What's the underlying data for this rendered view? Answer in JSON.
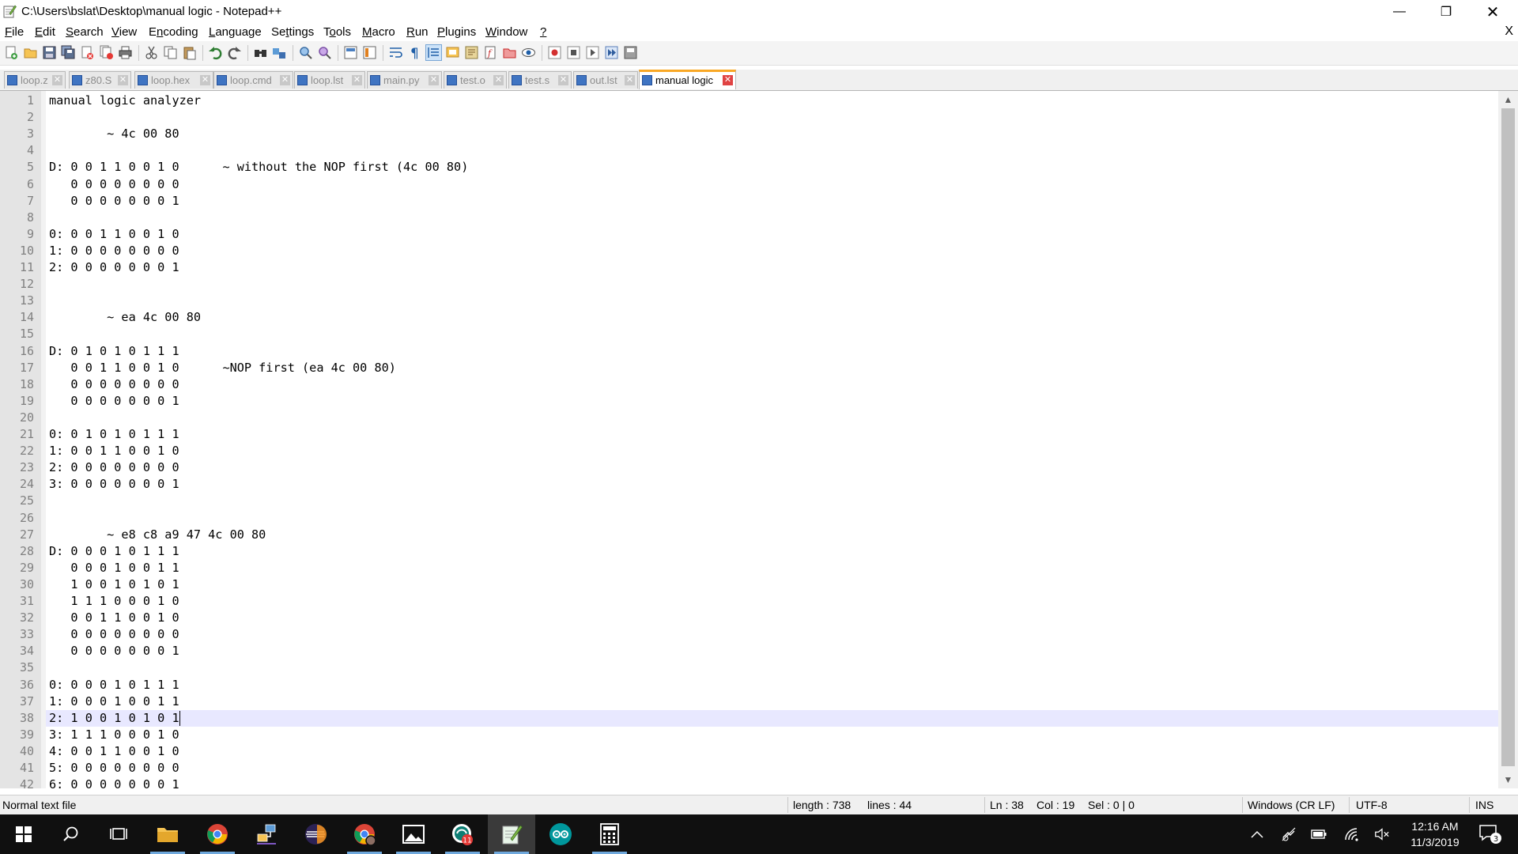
{
  "window": {
    "title": "C:\\Users\\bslat\\Desktop\\manual logic - Notepad++",
    "minimize": "—",
    "maximize": "❐",
    "close": "✕"
  },
  "menu": {
    "items": [
      {
        "u": "F",
        "rest": "ile"
      },
      {
        "u": "E",
        "rest": "dit"
      },
      {
        "u": "S",
        "rest": "earch"
      },
      {
        "u": "V",
        "rest": "iew"
      },
      {
        "u": "",
        "pre": "E",
        "u2": "n",
        "rest": "coding"
      },
      {
        "u": "L",
        "rest": "anguage"
      },
      {
        "u": "",
        "pre": "Se",
        "u2": "t",
        "rest": "tings"
      },
      {
        "u": "",
        "pre": "T",
        "u2": "o",
        "rest": "ols"
      },
      {
        "u": "M",
        "rest": "acro"
      },
      {
        "u": "R",
        "rest": "un"
      },
      {
        "u": "P",
        "rest": "lugins"
      },
      {
        "u": "W",
        "rest": "indow"
      },
      {
        "u": "?",
        "rest": ""
      }
    ],
    "close_doc": "X"
  },
  "tabs": [
    {
      "label": "loop.z",
      "active": false
    },
    {
      "label": "z80.S",
      "active": false
    },
    {
      "label": "loop.hex",
      "active": false
    },
    {
      "label": "loop.cmd",
      "active": false
    },
    {
      "label": "loop.lst",
      "active": false
    },
    {
      "label": "main.py",
      "active": false
    },
    {
      "label": "test.o",
      "active": false
    },
    {
      "label": "test.s",
      "active": false
    },
    {
      "label": "out.lst",
      "active": false
    },
    {
      "label": "manual logic",
      "active": true
    }
  ],
  "tab_close_glyph": "✕",
  "editor": {
    "first_line_number": 1,
    "current_line": 38,
    "caret_col": 19,
    "lines": [
      "manual logic analyzer",
      "",
      "        ~ 4c 00 80",
      "",
      "D: 0 0 1 1 0 0 1 0      ~ without the NOP first (4c 00 80)",
      "   0 0 0 0 0 0 0 0",
      "   0 0 0 0 0 0 0 1",
      "",
      "0: 0 0 1 1 0 0 1 0",
      "1: 0 0 0 0 0 0 0 0",
      "2: 0 0 0 0 0 0 0 1",
      "",
      "",
      "        ~ ea 4c 00 80",
      "",
      "D: 0 1 0 1 0 1 1 1",
      "   0 0 1 1 0 0 1 0      ~NOP first (ea 4c 00 80)",
      "   0 0 0 0 0 0 0 0",
      "   0 0 0 0 0 0 0 1",
      "",
      "0: 0 1 0 1 0 1 1 1",
      "1: 0 0 1 1 0 0 1 0",
      "2: 0 0 0 0 0 0 0 0",
      "3: 0 0 0 0 0 0 0 1",
      "",
      "",
      "        ~ e8 c8 a9 47 4c 00 80",
      "D: 0 0 0 1 0 1 1 1",
      "   0 0 0 1 0 0 1 1",
      "   1 0 0 1 0 1 0 1",
      "   1 1 1 0 0 0 1 0",
      "   0 0 1 1 0 0 1 0",
      "   0 0 0 0 0 0 0 0",
      "   0 0 0 0 0 0 0 1",
      "",
      "0: 0 0 0 1 0 1 1 1",
      "1: 0 0 0 1 0 0 1 1",
      "2: 1 0 0 1 0 1 0 1",
      "3: 1 1 1 0 0 0 1 0",
      "4: 0 0 1 1 0 0 1 0",
      "5: 0 0 0 0 0 0 0 0",
      "6: 0 0 0 0 0 0 0 1"
    ],
    "scroll_up": "▲",
    "scroll_down": "▼"
  },
  "status": {
    "file_type": "Normal text file",
    "length": "length : 738",
    "lines": "lines : 44",
    "ln": "Ln : 38",
    "col": "Col : 19",
    "sel": "Sel : 0 | 0",
    "eol": "Windows (CR LF)",
    "encoding": "UTF-8",
    "mode": "INS"
  },
  "taskbar": {
    "apps": [
      "start-icon",
      "search-icon",
      "task-view-icon",
      "file-explorer-icon",
      "chrome-icon",
      "network-app-icon",
      "eclipse-icon",
      "chrome-profile-icon",
      "photos-icon",
      "git-kraken-icon",
      "notepadpp-icon",
      "arduino-icon",
      "calculator-icon"
    ],
    "badge_count": "11",
    "clock_time": "12:16 AM",
    "clock_date": "11/3/2019",
    "notification_count": "3"
  },
  "colors": {
    "active_tab_accent": "#f9a825",
    "current_line_highlight": "#e8e8ff",
    "taskbar": "#101010"
  }
}
